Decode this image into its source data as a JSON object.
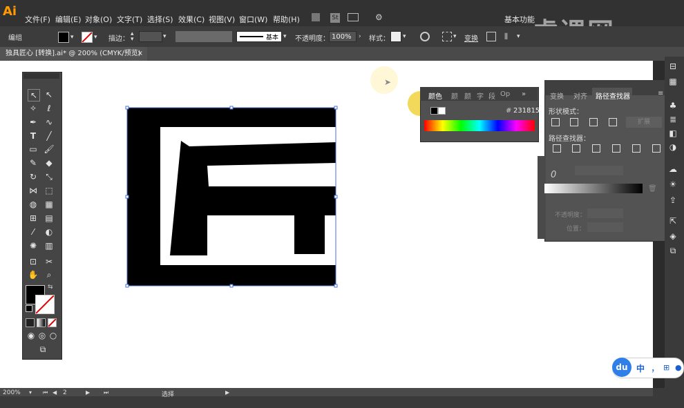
{
  "app": {
    "logo": "Ai"
  },
  "menu": [
    "文件(F)",
    "编辑(E)",
    "对象(O)",
    "文字(T)",
    "选择(S)",
    "效果(C)",
    "视图(V)",
    "窗口(W)",
    "帮助(H)"
  ],
  "workspace": {
    "label": "基本功能"
  },
  "watermark": {
    "text": "虎课网"
  },
  "control_bar": {
    "group_label": "编组",
    "stroke_label": "描边：",
    "stroke_profile": "基本",
    "opacity_label": "不透明度：",
    "opacity_value": "100%",
    "style_label": "样式：",
    "transform_label": "变换"
  },
  "document": {
    "tab_title": "独具匠心 [转换].ai* @ 200% (CMYK/预览)",
    "close": "×"
  },
  "color_panel": {
    "tabs": [
      "颜色",
      "颜",
      "颜",
      "字",
      "段",
      "Op"
    ],
    "hex_label": "#",
    "hex_value": "231815"
  },
  "pathfinder_panel": {
    "tabs": [
      "变换",
      "对齐",
      "路径查找器"
    ],
    "shape_modes_label": "形状模式：",
    "expand_label": "扩展",
    "pathfinders_label": "路径查找器：",
    "opacity_label": "不透明度：",
    "position_label": "位置："
  },
  "status_bar": {
    "zoom": "200%",
    "page": "2",
    "selection_mode": "选择"
  },
  "ime_widget": {
    "logo": "du",
    "mode": "中",
    "punct": "，"
  }
}
